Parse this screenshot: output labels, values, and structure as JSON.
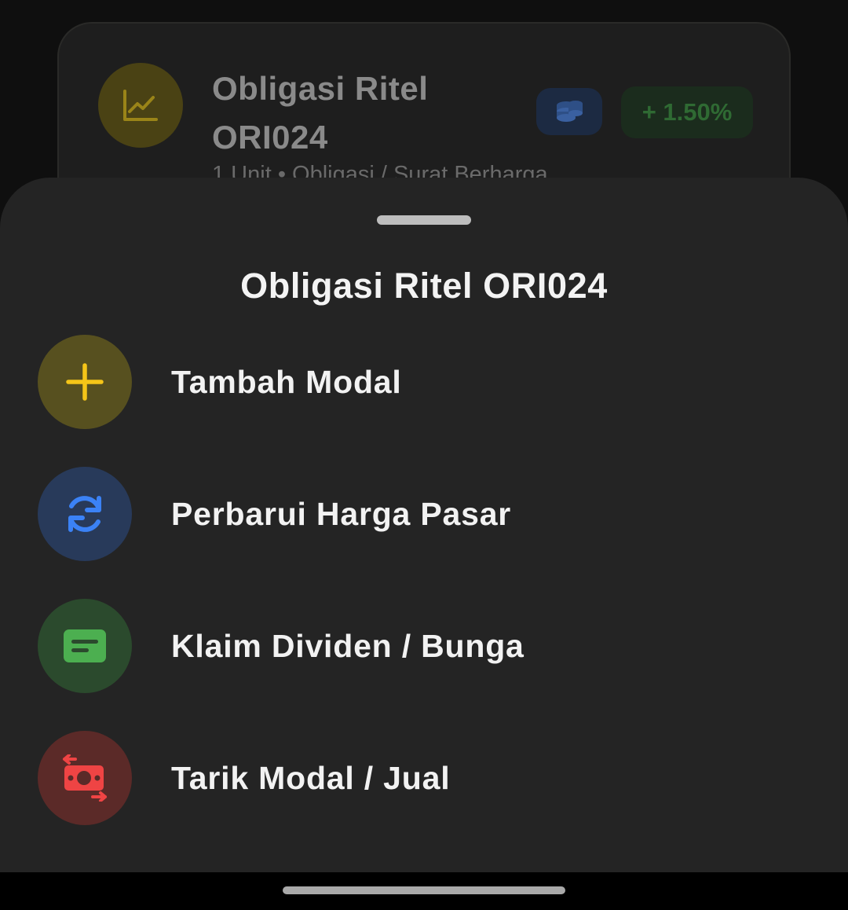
{
  "background_card": {
    "title": "Obligasi Ritel ORI024",
    "subtitle": "1 Unit • Obligasi / Surat Berharga",
    "change_badge": "+ 1.50%",
    "icon": "line-chart-icon",
    "type_icon": "coins-icon"
  },
  "sheet": {
    "title": "Obligasi Ritel ORI024",
    "options": [
      {
        "label": "Tambah Modal",
        "icon": "plus-icon",
        "color": "#f5c518"
      },
      {
        "label": "Perbarui Harga Pasar",
        "icon": "refresh-icon",
        "color": "#3b82f6"
      },
      {
        "label": "Klaim Dividen / Bunga",
        "icon": "receipt-icon",
        "color": "#4caf50"
      },
      {
        "label": "Tarik Modal / Jual",
        "icon": "money-exchange-icon",
        "color": "#ef4444"
      }
    ]
  }
}
